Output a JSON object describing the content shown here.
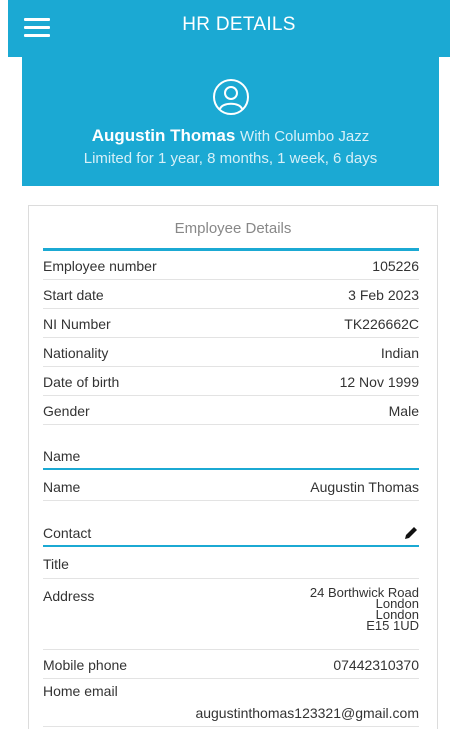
{
  "header": {
    "title": "HR DETAILS",
    "menu_icon": "hamburger-icon"
  },
  "profile": {
    "avatar_icon": "user-circle-icon",
    "name": "Augustin Thomas",
    "company": "With Columbo Jazz",
    "tenure": "Limited for 1 year, 8 months, 1 week, 6 days"
  },
  "employee_details": {
    "title": "Employee Details",
    "rows": [
      {
        "label": "Employee number",
        "value": "105226"
      },
      {
        "label": "Start date",
        "value": "3 Feb 2023"
      },
      {
        "label": "NI Number",
        "value": "TK226662C"
      },
      {
        "label": "Nationality",
        "value": "Indian"
      },
      {
        "label": "Date of birth",
        "value": "12 Nov 1999"
      },
      {
        "label": "Gender",
        "value": "Male"
      }
    ]
  },
  "name_section": {
    "heading": "Name",
    "rows": [
      {
        "label": "Name",
        "value": "Augustin Thomas"
      }
    ]
  },
  "contact_section": {
    "heading": "Contact",
    "edit_icon": "pencil-icon",
    "title_label": "Title",
    "address_label": "Address",
    "address_lines": [
      "24 Borthwick Road",
      "London",
      "London",
      "E15 1UD"
    ],
    "mobile_label": "Mobile phone",
    "mobile_value": "07442310370",
    "email_label": "Home email",
    "email_value": "augustinthomas123321@gmail.com"
  },
  "colors": {
    "accent": "#1ba9d3"
  }
}
